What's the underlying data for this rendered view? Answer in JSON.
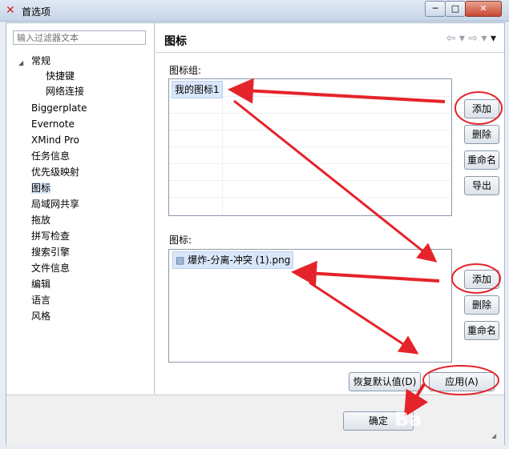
{
  "window": {
    "title": "首选项"
  },
  "left_panel": {
    "filter_placeholder": "输入过滤器文本",
    "items": [
      {
        "label": "常规"
      },
      {
        "label": "快捷键"
      },
      {
        "label": "网络连接"
      },
      {
        "label": "Biggerplate"
      },
      {
        "label": "Evernote"
      },
      {
        "label": "XMind Pro"
      },
      {
        "label": "任务信息"
      },
      {
        "label": "优先级映射"
      },
      {
        "label": "图标"
      },
      {
        "label": "局域网共享"
      },
      {
        "label": "拖放"
      },
      {
        "label": "拼写检查"
      },
      {
        "label": "搜索引擎"
      },
      {
        "label": "文件信息"
      },
      {
        "label": "编辑"
      },
      {
        "label": "语言"
      },
      {
        "label": "风格"
      }
    ]
  },
  "main": {
    "page_title": "图标",
    "icon_groups_label": "图标组:",
    "icon_groups": [
      "我的图标1"
    ],
    "icon_group_buttons": [
      "添加",
      "删除",
      "重命名",
      "导出"
    ],
    "icons_label": "图标:",
    "icons": [
      "爆炸-分离-冲突 (1).png"
    ],
    "icon_buttons": [
      "添加",
      "删除",
      "重命名"
    ],
    "restore_defaults_button": "恢复默认值(D)",
    "apply_button": "应用(A)",
    "ok_button": "确定"
  },
  "watermark": {
    "text": "Ba"
  },
  "colors": {
    "annotation_red": "#e5232a",
    "selection_blue": "#d9e7fa"
  }
}
